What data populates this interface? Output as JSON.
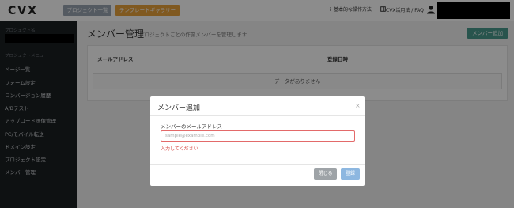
{
  "header": {
    "logo": "CVX",
    "nav_projects": "プロジェクト一覧",
    "nav_templates": "テンプレートギャラリー",
    "howto": "基本的な操作方法",
    "faq": "CVX活用法 / FAQ"
  },
  "sidebar": {
    "project_name_label": "プロジェクト名",
    "menu_label": "プロジェクトメニュー",
    "items": [
      {
        "label": "ページ一覧"
      },
      {
        "label": "フォーム設定"
      },
      {
        "label": "コンバージョン履歴"
      },
      {
        "label": "A/Bテスト"
      },
      {
        "label": "アップロード画像管理"
      },
      {
        "label": "PC/モバイル転送"
      },
      {
        "label": "ドメイン設定"
      },
      {
        "label": "プロジェクト設定"
      },
      {
        "label": "メンバー管理"
      }
    ]
  },
  "main": {
    "title": "メンバー管理",
    "subtitle": "プロジェクトごとの作業メンバーを管理します",
    "add_button": "メンバー追加",
    "columns": [
      "メールアドレス",
      "登録日時"
    ],
    "empty_text": "データがありません"
  },
  "modal": {
    "title": "メンバー追加",
    "close_symbol": "×",
    "field_label": "メンバーのメールアドレス",
    "placeholder": "sample@example.com",
    "error": "入力してください",
    "close_button": "閉じる",
    "register_button": "登録"
  }
}
